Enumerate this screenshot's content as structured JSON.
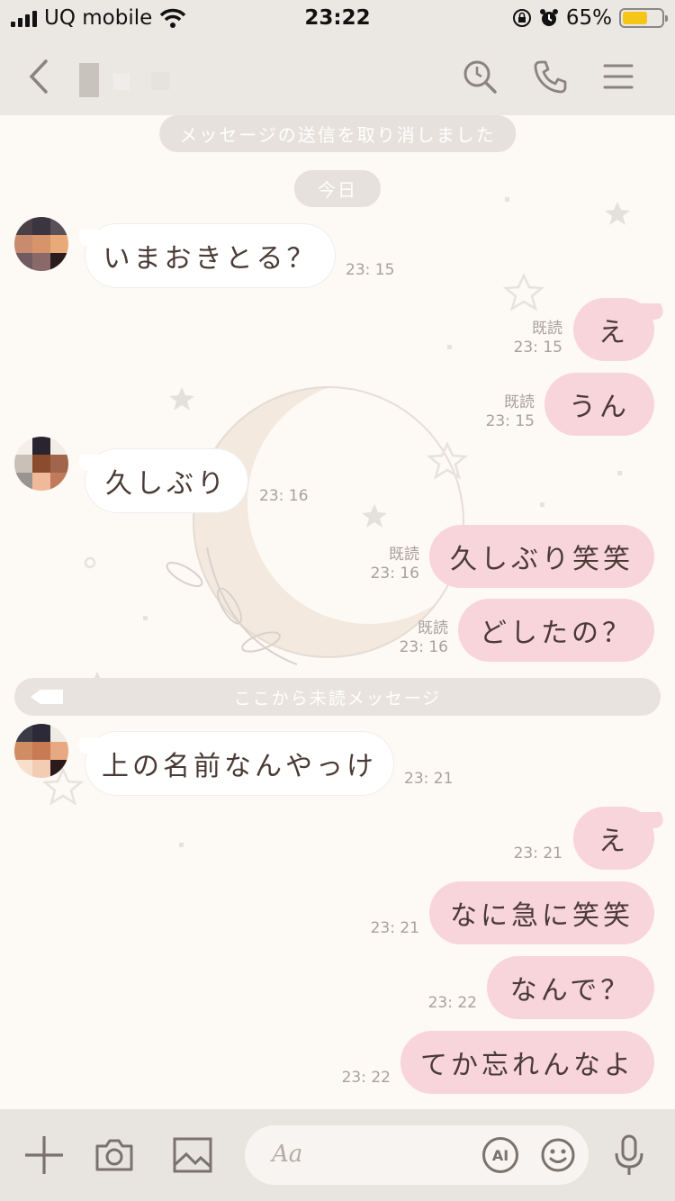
{
  "status": {
    "carrier": "UQ mobile",
    "time": "23:22",
    "battery_text": "65%",
    "battery_level": 0.65
  },
  "header": {
    "back_icon": "chevron-left-icon",
    "search_icon": "search-icon",
    "call_icon": "phone-icon",
    "menu_icon": "menu-icon"
  },
  "chat": {
    "system_message": "メッセージの送信を取り消しました",
    "date_label": "今日",
    "unread_divider": "ここから未読メッセージ",
    "messages": [
      {
        "dir": "in",
        "text": "いまおきとる？",
        "time": "23: 15",
        "read": ""
      },
      {
        "dir": "out",
        "text": "え",
        "time": "23: 15",
        "read": "既読"
      },
      {
        "dir": "out",
        "text": "うん",
        "time": "23: 15",
        "read": "既読"
      },
      {
        "dir": "in",
        "text": "久しぶり",
        "time": "23: 16",
        "read": ""
      },
      {
        "dir": "out",
        "text": "久しぶり笑笑",
        "time": "23: 16",
        "read": "既読"
      },
      {
        "dir": "out",
        "text": "どしたの？",
        "time": "23: 16",
        "read": "既読"
      },
      {
        "dir": "in",
        "text": "上の名前なんやっけ",
        "time": "23: 21",
        "read": ""
      },
      {
        "dir": "out",
        "text": "え",
        "time": "23: 21",
        "read": ""
      },
      {
        "dir": "out",
        "text": "なに急に笑笑",
        "time": "23: 21",
        "read": ""
      },
      {
        "dir": "out",
        "text": "なんで？",
        "time": "23: 22",
        "read": ""
      },
      {
        "dir": "out",
        "text": "てか忘れんなよ",
        "time": "23: 22",
        "read": ""
      }
    ]
  },
  "input": {
    "placeholder": "Aa",
    "ai_label": "AI"
  },
  "colors": {
    "outgoing_bubble": "#f8d4db",
    "incoming_bubble": "#ffffff",
    "background": "#fdf9f5"
  }
}
